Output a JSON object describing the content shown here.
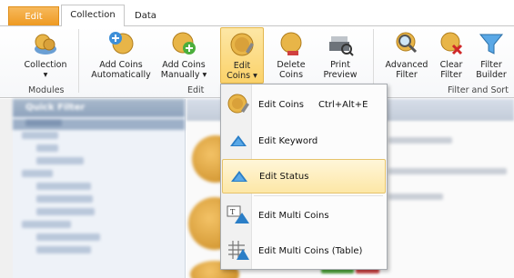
{
  "tabs": {
    "edit": "Edit",
    "collection": "Collection",
    "data": "Data"
  },
  "ribbon": {
    "buttons": [
      {
        "label1": "Collection",
        "label2": "▾",
        "icon": "collection-coins-icon"
      },
      {
        "label1": "Add Coins",
        "label2": "Automatically",
        "icon": "add-coins-auto-icon"
      },
      {
        "label1": "Add Coins",
        "label2": "Manually ▾",
        "icon": "add-coins-manual-icon"
      },
      {
        "label1": "Edit",
        "label2": "Coins ▾",
        "icon": "edit-coins-icon"
      },
      {
        "label1": "Delete",
        "label2": "Coins",
        "icon": "delete-coins-icon"
      },
      {
        "label1": "Print",
        "label2": "Preview",
        "icon": "print-preview-icon"
      },
      {
        "label1": "Advanced",
        "label2": "Filter",
        "icon": "advanced-filter-icon"
      },
      {
        "label1": "Clear",
        "label2": "Filter",
        "icon": "clear-filter-icon"
      },
      {
        "label1": "Filter",
        "label2": "Builder",
        "icon": "filter-builder-icon"
      }
    ],
    "groups": {
      "modules": "Modules",
      "edit": "Edit",
      "filter_sort": "Filter and Sort"
    }
  },
  "left_pane": {
    "title": "Quick Filter"
  },
  "menu": {
    "items": [
      {
        "label": "Edit Coins",
        "shortcut": "Ctrl+Alt+E",
        "icon": "edit-coins-icon"
      },
      {
        "label": "Edit Keyword",
        "shortcut": "",
        "icon": "keyword-triangle-icon"
      },
      {
        "label": "Edit Status",
        "shortcut": "",
        "icon": "status-triangle-icon"
      },
      {
        "label": "Edit Multi Coins",
        "shortcut": "",
        "icon": "multi-coins-icon"
      },
      {
        "label": "Edit Multi Coins (Table)",
        "shortcut": "",
        "icon": "multi-coins-table-icon"
      }
    ]
  },
  "colors": {
    "accent_orange": "#ee9a22",
    "highlight": "#fde7a6",
    "triangle_blue": "#2a7ec7"
  }
}
